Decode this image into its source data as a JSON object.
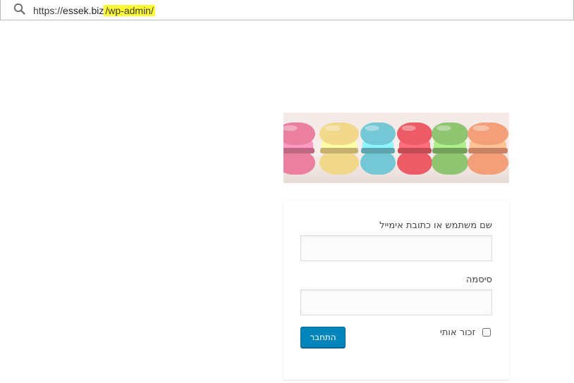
{
  "browser": {
    "url_prefix": "https://",
    "url_host": "essek.biz",
    "url_path": "/wp-admin/",
    "search_icon": "search-icon",
    "highlight_color": "#ffff33"
  },
  "banner": {
    "image_name": "macarons-banner",
    "macaron_colors": [
      "#ea7fa0",
      "#f1d88a",
      "#74c8d6",
      "#ec5b66",
      "#8fc470",
      "#f3a07a"
    ]
  },
  "login_form": {
    "username_label": "שם משתמש או כתובת אימייל",
    "username_value": "",
    "password_label": "סיסמה",
    "password_value": "",
    "remember_label": "זכור אותי",
    "remember_checked": false,
    "submit_label": "התחבר",
    "accent_color": "#0085ba"
  }
}
